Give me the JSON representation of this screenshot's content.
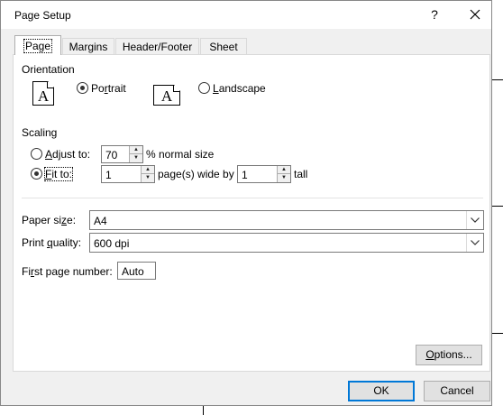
{
  "window": {
    "title": "Page Setup",
    "help_glyph": "?",
    "close_glyph": "✕"
  },
  "tabs": [
    {
      "label": "Page",
      "active": true
    },
    {
      "label": "Margins",
      "active": false
    },
    {
      "label": "Header/Footer",
      "active": false
    },
    {
      "label": "Sheet",
      "active": false
    }
  ],
  "orientation": {
    "heading": "Orientation",
    "portrait_pre": "Po",
    "portrait_u": "r",
    "portrait_post": "trait",
    "landscape_u": "L",
    "landscape_post": "andscape",
    "icon_glyph": "A",
    "selected": "portrait"
  },
  "scaling": {
    "heading": "Scaling",
    "adjust_u": "A",
    "adjust_post": "djust to:",
    "adjust_value": "70",
    "adjust_suffix": "% normal size",
    "fit_u": "F",
    "fit_post": "it to:",
    "fit_wide_value": "1",
    "fit_wide_suffix": "page(s) wide by",
    "fit_tall_value": "1",
    "fit_tall_suffix": "tall",
    "selected": "fit"
  },
  "paper_size": {
    "label_pre": "Paper si",
    "label_u": "z",
    "label_post": "e:",
    "value": "A4"
  },
  "print_quality": {
    "label_pre": "Print ",
    "label_u": "q",
    "label_post": "uality:",
    "value": "600 dpi"
  },
  "first_page": {
    "label_pre": "Fi",
    "label_u": "r",
    "label_post": "st page number:",
    "value": "Auto"
  },
  "buttons": {
    "options_u": "O",
    "options_post": "ptions...",
    "ok": "OK",
    "cancel": "Cancel"
  },
  "glyphs": {
    "up": "▲",
    "down": "▼",
    "dropdown": "⌵"
  }
}
